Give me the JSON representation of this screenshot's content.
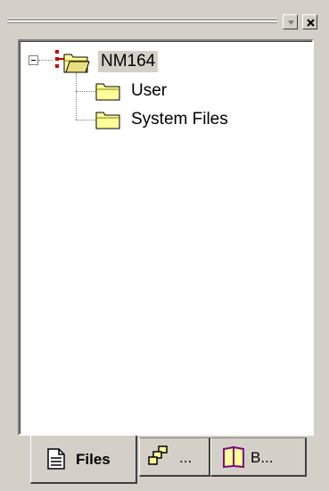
{
  "window": {
    "icons": {
      "menu": "dropdown-arrow-icon",
      "close": "close-x-icon"
    }
  },
  "tree": {
    "root": {
      "label": "NM164",
      "icon": "project-folder-icon",
      "expanded": true
    },
    "children": [
      {
        "label": "User",
        "icon": "folder-icon"
      },
      {
        "label": "System Files",
        "icon": "folder-icon"
      }
    ]
  },
  "tabs": [
    {
      "label": "Files",
      "icon": "document-icon",
      "active": true
    },
    {
      "label": "...",
      "icon": "classes-icon",
      "active": false
    },
    {
      "label": "B...",
      "icon": "book-icon",
      "active": false
    }
  ],
  "colors": {
    "face": "#d4d0c8",
    "folder": "#ffff99",
    "selection": "#d4d0c8"
  }
}
